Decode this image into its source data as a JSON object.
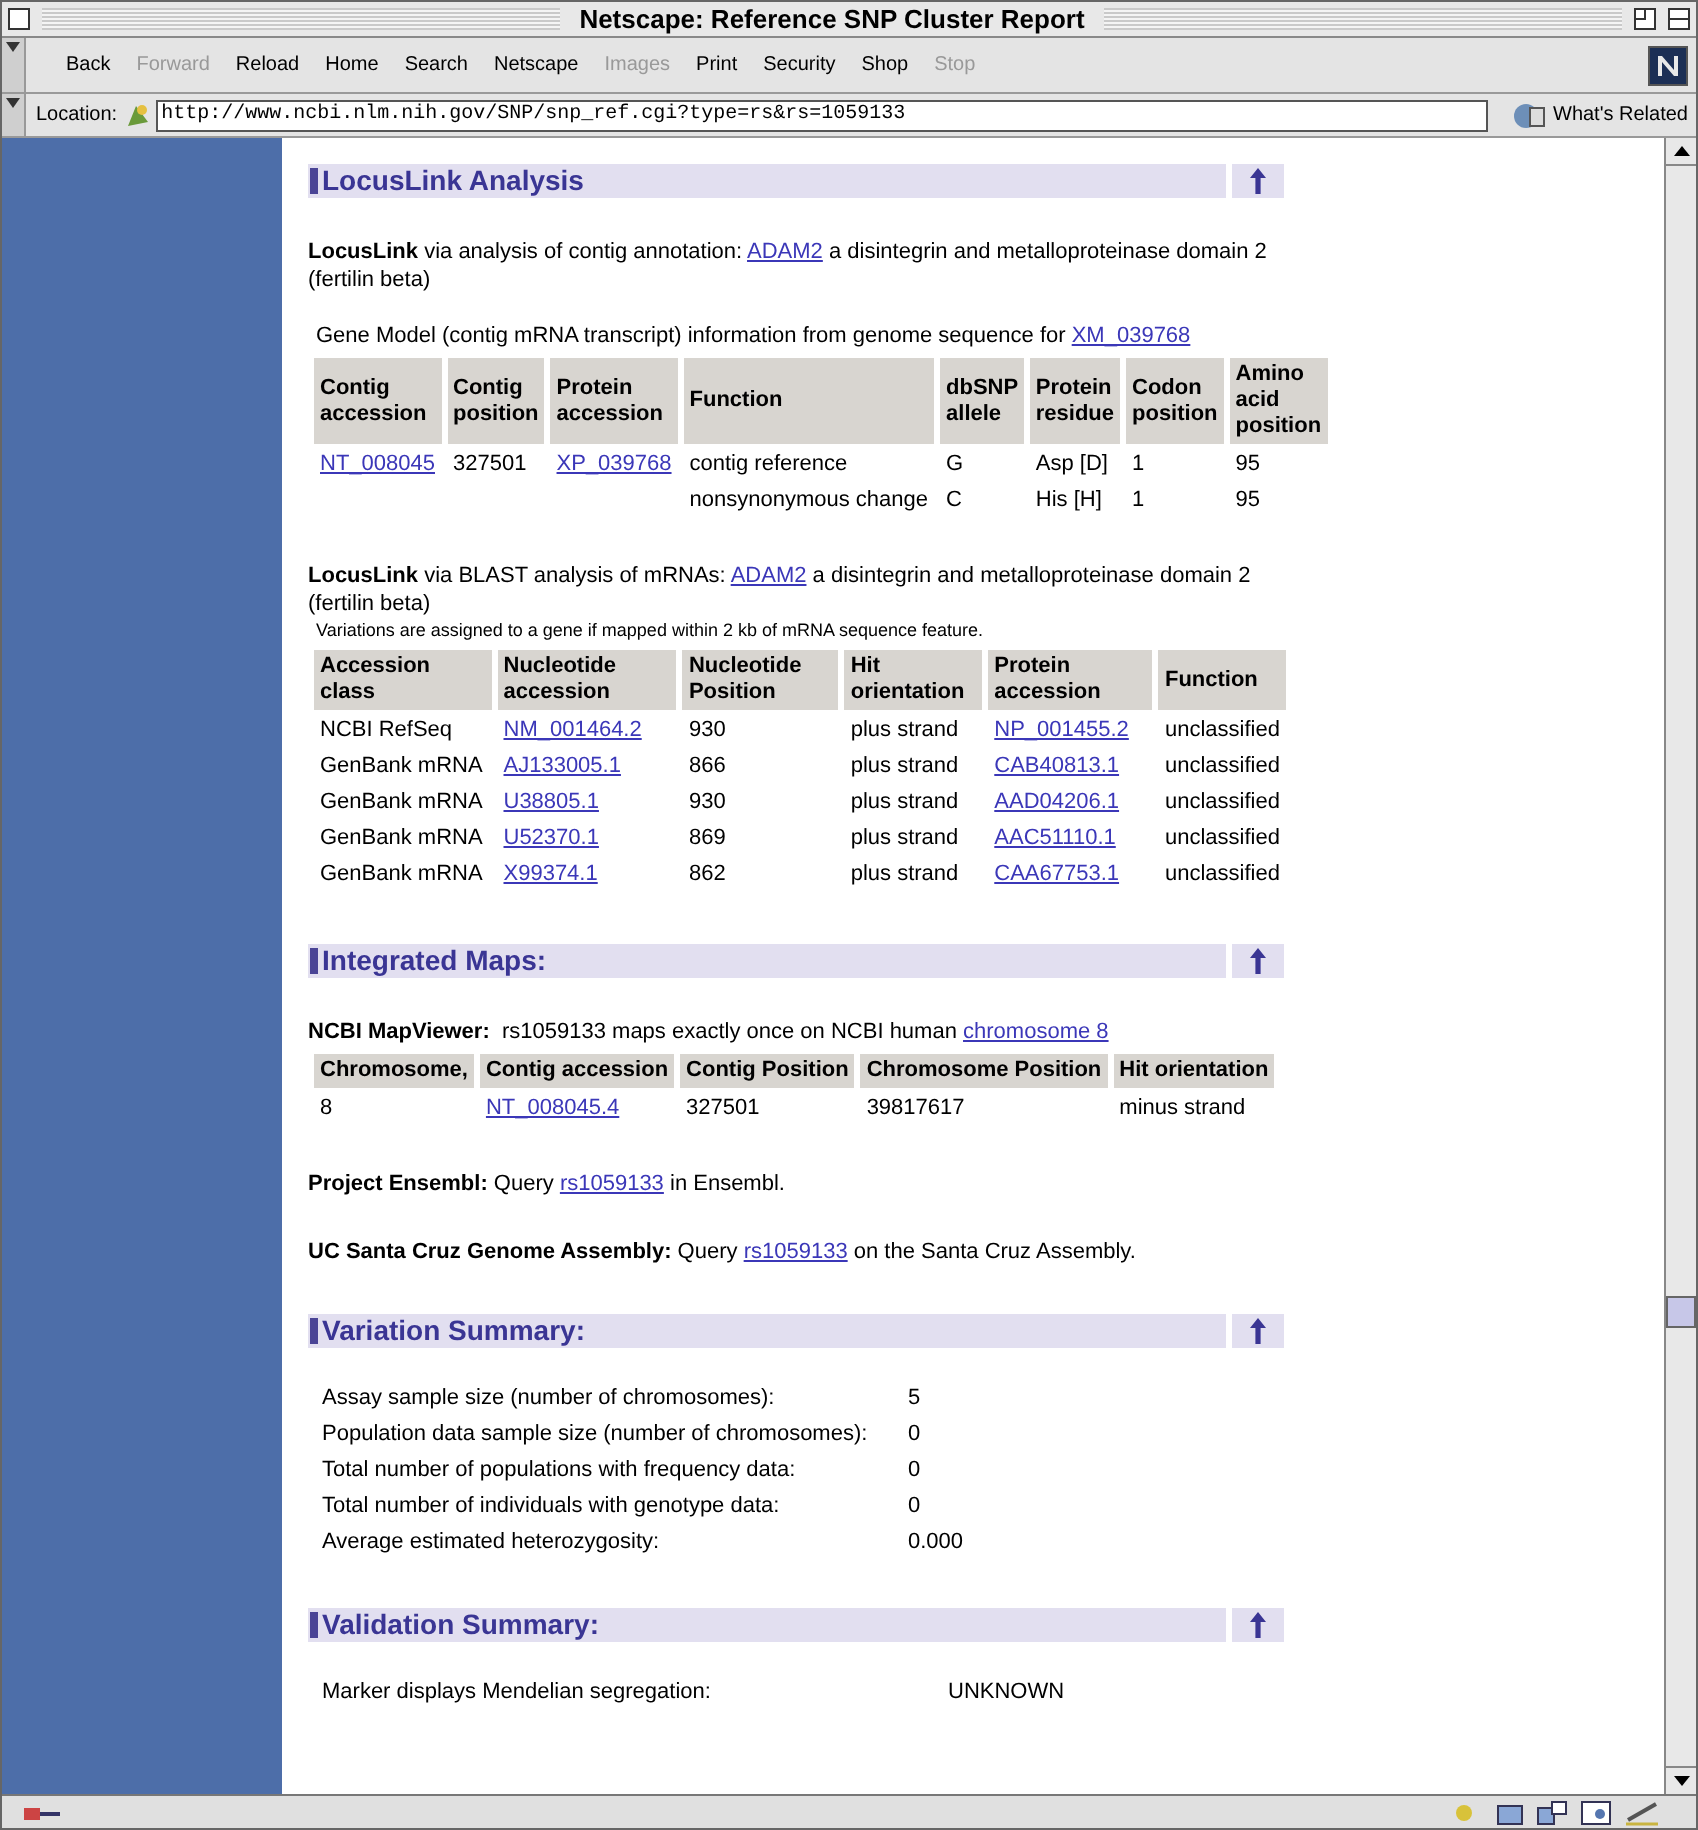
{
  "window": {
    "title": "Netscape: Reference SNP Cluster Report"
  },
  "toolbar": [
    {
      "label": "Back",
      "disabled": false
    },
    {
      "label": "Forward",
      "disabled": true
    },
    {
      "label": "Reload",
      "disabled": false
    },
    {
      "label": "Home",
      "disabled": false
    },
    {
      "label": "Search",
      "disabled": false
    },
    {
      "label": "Netscape",
      "disabled": false
    },
    {
      "label": "Images",
      "disabled": true
    },
    {
      "label": "Print",
      "disabled": false
    },
    {
      "label": "Security",
      "disabled": false
    },
    {
      "label": "Shop",
      "disabled": false
    },
    {
      "label": "Stop",
      "disabled": true
    }
  ],
  "location": {
    "label": "Location:",
    "url": "http://www.ncbi.nlm.nih.gov/SNP/snp_ref.cgi?type=rs&rs=1059133",
    "related": "What's Related"
  },
  "sections": [
    {
      "title": "LocusLink Analysis",
      "blocks": [
        {
          "kind": "paragraph",
          "segments": [
            {
              "kind": "bold",
              "text": "LocusLink"
            },
            {
              "kind": "text",
              "text": " via analysis of contig annotation: "
            },
            {
              "kind": "link",
              "text": "ADAM2"
            },
            {
              "kind": "text",
              "text": " a disintegrin and metalloproteinase domain 2 (fertilin beta)"
            }
          ]
        },
        {
          "kind": "caption",
          "segments": [
            {
              "kind": "text",
              "text": "Gene Model (contig mRNA transcript) information from genome sequence for "
            },
            {
              "kind": "link",
              "text": "XM_039768"
            }
          ]
        },
        {
          "kind": "table",
          "columns": [
            "Contig accession",
            "Contig position",
            "Protein accession",
            "Function",
            "dbSNP allele",
            "Protein residue",
            "Codon position",
            "Amino acid position"
          ],
          "rows": [
            [
              {
                "text": "NT_008045",
                "link": true
              },
              {
                "text": "327501",
                "link": false
              },
              {
                "text": "XP_039768",
                "link": true
              },
              {
                "text": "contig reference",
                "link": false
              },
              {
                "text": "G",
                "link": false
              },
              {
                "text": "Asp [D]",
                "link": false
              },
              {
                "text": "1",
                "link": false
              },
              {
                "text": "95",
                "link": false
              }
            ],
            [
              null,
              null,
              null,
              {
                "text": "nonsynonymous change",
                "link": false
              },
              {
                "text": "C",
                "link": false
              },
              {
                "text": "His [H]",
                "link": false
              },
              {
                "text": "1",
                "link": false
              },
              {
                "text": "95",
                "link": false
              }
            ]
          ]
        },
        {
          "kind": "paragraph",
          "segments": [
            {
              "kind": "bold",
              "text": "LocusLink"
            },
            {
              "kind": "text",
              "text": " via BLAST analysis of mRNAs: "
            },
            {
              "kind": "link",
              "text": "ADAM2"
            },
            {
              "kind": "text",
              "text": " a disintegrin and metalloproteinase domain 2 (fertilin beta)"
            }
          ]
        },
        {
          "kind": "note",
          "segments": [
            {
              "kind": "text",
              "text": "Variations are assigned to a gene if mapped within 2 kb of mRNA sequence feature."
            }
          ]
        },
        {
          "kind": "table",
          "columns": [
            "Accession class",
            "Nucleotide accession",
            "Nucleotide Position",
            "Hit orientation",
            "Protein accession",
            "Function"
          ],
          "rows": [
            [
              {
                "text": "NCBI RefSeq",
                "link": false
              },
              {
                "text": "NM_001464.2",
                "link": true
              },
              {
                "text": "930",
                "link": false
              },
              {
                "text": "plus strand",
                "link": false
              },
              {
                "text": "NP_001455.2",
                "link": true
              },
              {
                "text": "unclassified",
                "link": false
              }
            ],
            [
              {
                "text": "GenBank mRNA",
                "link": false
              },
              {
                "text": "AJ133005.1",
                "link": true
              },
              {
                "text": "866",
                "link": false
              },
              {
                "text": "plus strand",
                "link": false
              },
              {
                "text": "CAB40813.1",
                "link": true
              },
              {
                "text": "unclassified",
                "link": false
              }
            ],
            [
              {
                "text": "GenBank mRNA",
                "link": false
              },
              {
                "text": "U38805.1",
                "link": true
              },
              {
                "text": "930",
                "link": false
              },
              {
                "text": "plus strand",
                "link": false
              },
              {
                "text": "AAD04206.1",
                "link": true
              },
              {
                "text": "unclassified",
                "link": false
              }
            ],
            [
              {
                "text": "GenBank mRNA",
                "link": false
              },
              {
                "text": "U52370.1",
                "link": true
              },
              {
                "text": "869",
                "link": false
              },
              {
                "text": "plus strand",
                "link": false
              },
              {
                "text": "AAC51110.1",
                "link": true
              },
              {
                "text": "unclassified",
                "link": false
              }
            ],
            [
              {
                "text": "GenBank mRNA",
                "link": false
              },
              {
                "text": "X99374.1",
                "link": true
              },
              {
                "text": "862",
                "link": false
              },
              {
                "text": "plus strand",
                "link": false
              },
              {
                "text": "CAA67753.1",
                "link": true
              },
              {
                "text": "unclassified",
                "link": false
              }
            ]
          ]
        }
      ]
    },
    {
      "title": "Integrated Maps:",
      "blocks": [
        {
          "kind": "paragraph",
          "segments": [
            {
              "kind": "bold",
              "text": "NCBI MapViewer:"
            },
            {
              "kind": "text",
              "text": "  rs1059133 maps exactly once on NCBI human "
            },
            {
              "kind": "link",
              "text": "chromosome 8"
            }
          ]
        },
        {
          "kind": "table",
          "columns": [
            "Chromosome,",
            "Contig accession",
            "Contig Position",
            "Chromosome Position",
            "Hit orientation"
          ],
          "rows": [
            [
              {
                "text": "8",
                "link": false
              },
              {
                "text": "NT_008045.4",
                "link": true
              },
              {
                "text": "327501",
                "link": false
              },
              {
                "text": "39817617",
                "link": false
              },
              {
                "text": "minus strand",
                "link": false
              }
            ]
          ]
        },
        {
          "kind": "paragraph",
          "segments": [
            {
              "kind": "bold",
              "text": "Project Ensembl:"
            },
            {
              "kind": "text",
              "text": " Query "
            },
            {
              "kind": "link",
              "text": "rs1059133"
            },
            {
              "kind": "text",
              "text": " in Ensembl."
            }
          ]
        },
        {
          "kind": "paragraph",
          "segments": [
            {
              "kind": "bold",
              "text": "UC Santa Cruz Genome Assembly:"
            },
            {
              "kind": "text",
              "text": " Query "
            },
            {
              "kind": "link",
              "text": "rs1059133"
            },
            {
              "kind": "text",
              "text": " on the Santa Cruz Assembly."
            }
          ]
        }
      ]
    },
    {
      "title": "Variation Summary:",
      "blocks": [
        {
          "kind": "pairs",
          "pairs": [
            {
              "label": "Assay sample size (number of chromosomes):",
              "value": "5"
            },
            {
              "label": "Population data sample size (number of chromosomes):",
              "value": "0"
            },
            {
              "label": "Total number of populations with frequency data:",
              "value": "0"
            },
            {
              "label": "Total number of individuals with genotype data:",
              "value": "0"
            },
            {
              "label": "Average estimated heterozygosity:",
              "value": "0.000"
            }
          ]
        }
      ]
    },
    {
      "title": "Validation Summary:",
      "blocks": [
        {
          "kind": "pairs",
          "pairs": [
            {
              "label": "Marker displays Mendelian segregation:",
              "value": "UNKNOWN"
            }
          ]
        }
      ]
    }
  ]
}
